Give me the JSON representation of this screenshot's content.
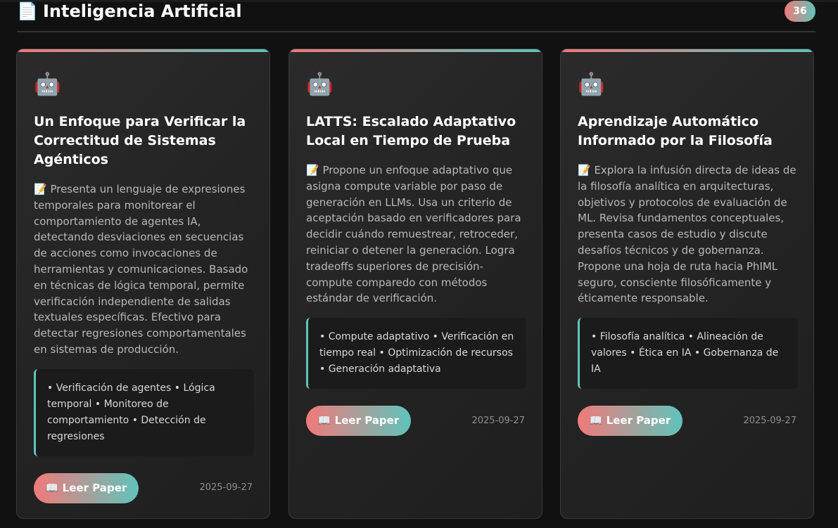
{
  "header": {
    "icon": "document-icon",
    "icon_glyph": "📄",
    "title": "Inteligencia Artificial",
    "count": "36"
  },
  "colors": {
    "background": "#111111",
    "card": "#262626",
    "accent_start": "#f07a7a",
    "accent_end": "#5fc4bb",
    "text_muted": "#b8b8b8"
  },
  "cards": [
    {
      "icon": "robot-icon",
      "icon_glyph": "🤖",
      "title": "Un Enfoque para Verificar la Correctitud de Sistemas Agénticos",
      "description": "📝 Presenta un lenguaje de expresiones temporales para monitorear el comportamiento de agentes IA, detectando desviaciones en secuencias de acciones como invocaciones de herramientas y comunicaciones. Basado en técnicas de lógica temporal, permite verificación independiente de salidas textuales específicas. Efectivo para detectar regresiones comportamentales en sistemas de producción.",
      "tags": "• Verificación de agentes • Lógica temporal • Monitoreo de comportamiento • Detección de regresiones",
      "button": "📖 Leer Paper",
      "date": "2025-09-27"
    },
    {
      "icon": "robot-icon",
      "icon_glyph": "🤖",
      "title": "LATTS: Escalado Adaptativo Local en Tiempo de Prueba",
      "description": "📝 Propone un enfoque adaptativo que asigna compute variable por paso de generación en LLMs. Usa un criterio de aceptación basado en verificadores para decidir cuándo remuestrear, retroceder, reiniciar o detener la generación. Logra tradeoffs superiores de precisión-compute comparedo con métodos estándar de verificación.",
      "tags": "• Compute adaptativo • Verificación en tiempo real • Optimización de recursos • Generación adaptativa",
      "button": "📖 Leer Paper",
      "date": "2025-09-27"
    },
    {
      "icon": "robot-icon",
      "icon_glyph": "🤖",
      "title": "Aprendizaje Automático Informado por la Filosofía",
      "description": "📝 Explora la infusión directa de ideas de la filosofía analítica en arquitecturas, objetivos y protocolos de evaluación de ML. Revisa fundamentos conceptuales, presenta casos de estudio y discute desafíos técnicos y de gobernanza. Propone una hoja de ruta hacia PhIML seguro, consciente filosóficamente y éticamente responsable.",
      "tags": "• Filosofía analítica • Alineación de valores • Ética en IA • Gobernanza de IA",
      "button": "📖 Leer Paper",
      "date": "2025-09-27"
    }
  ]
}
